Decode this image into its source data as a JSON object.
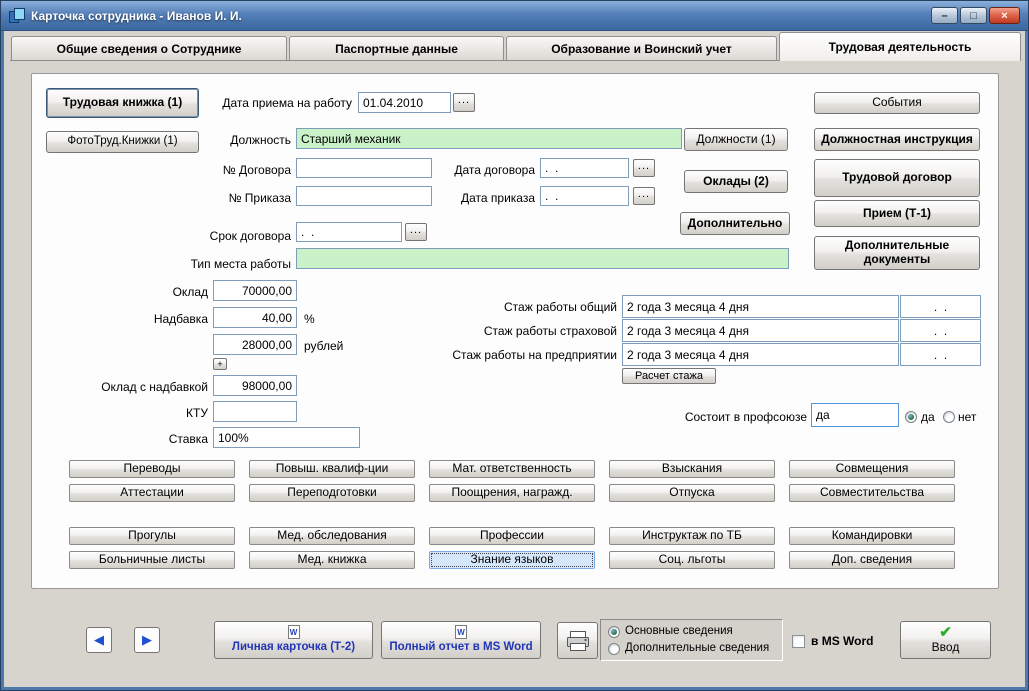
{
  "window": {
    "title": "Карточка сотрудника -  Иванов И. И.",
    "controls": {
      "minimize": "–",
      "maximize": "□",
      "close": "×"
    }
  },
  "tabs": [
    "Общие сведения о Сотруднике",
    "Паспортные данные",
    "Образование и Воинский учет",
    "Трудовая деятельность"
  ],
  "form": {
    "labor_book_btn": "Трудовая книжка (1)",
    "photo_book_btn": "ФотоТруд.Книжки (1)",
    "hire_date_label": "Дата приема на работу",
    "hire_date_value": "01.04.2010",
    "position_label": "Должность",
    "position_value": "Старший механик",
    "positions_btn": "Должности (1)",
    "contract_no_label": "№ Договора",
    "contract_no_value": "",
    "contract_date_label": "Дата договора",
    "contract_date_value": ".  .",
    "order_no_label": "№ Приказа",
    "order_no_value": "",
    "order_date_label": "Дата приказа",
    "order_date_value": ".  .",
    "salaries_btn": "Оклады (2)",
    "additional_btn": "Дополнительно",
    "contract_term_label": "Срок договора",
    "contract_term_value": ".  .",
    "workplace_type_label": "Тип места работы",
    "workplace_type_value": "",
    "salary_label": "Оклад",
    "salary_value": "70000,00",
    "bonus_label": "Надбавка",
    "bonus_value": "40,00",
    "bonus_unit": "%",
    "bonus_rub_value": "28000,00",
    "bonus_rub_unit": "рублей",
    "salary_total_label": "Оклад с надбавкой",
    "salary_total_value": "98000,00",
    "ktu_label": "КТУ",
    "ktu_value": "",
    "rate_label": "Ставка",
    "rate_value": "100%",
    "seniority": [
      {
        "label": "Стаж работы общий",
        "value": "2 года 3 месяца 4 дня",
        "date": ".  ."
      },
      {
        "label": "Стаж работы страховой",
        "value": "2 года 3 месяца 4 дня",
        "date": ".  ."
      },
      {
        "label": "Стаж работы на предприятии",
        "value": "2 года 3 месяца 4 дня",
        "date": ".  ."
      }
    ],
    "seniority_calc_btn": "Расчет стажа",
    "union_label": "Состоит в профсоюзе",
    "union_value": "да",
    "union_yes": "да",
    "union_no": "нет",
    "right_buttons": [
      "События",
      "Должностная инструкция",
      "Трудовой  договор",
      "Прием (Т-1)",
      "Дополнительные документы"
    ],
    "grid_rows": [
      [
        "Переводы",
        "Повыш. квалиф-ции",
        "Мат. ответственность",
        "Взыскания",
        "Совмещения"
      ],
      [
        "Аттестации",
        "Переподготовки",
        "Поощрения, награжд.",
        "Отпуска",
        "Совместительства"
      ],
      [
        "Прогулы",
        "Мед. обследования",
        "Профессии",
        "Инструктаж по ТБ",
        "Командировки"
      ],
      [
        "Больничные листы",
        "Мед. книжка",
        "Знание языков",
        "Соц. льготы",
        "Доп. сведения"
      ]
    ]
  },
  "footer": {
    "personal_card_btn": "Личная карточка (Т-2)",
    "full_report_btn": "Полный отчет в MS Word",
    "radio_main": "Основные сведения",
    "radio_additional": "Дополнительные сведения",
    "msword_checkbox": "в MS Word",
    "enter_btn": "Ввод"
  },
  "icons": {
    "ellipsis": "...",
    "plus": "+",
    "prev": "◀",
    "next": "▶",
    "check": "✔",
    "word_doc_letter": "W"
  },
  "colors": {
    "titlebar_blue": "#39689f",
    "field_green": "#c9f2c9",
    "link_blue": "#2135b5",
    "check_green": "#2fae2f",
    "focus_blue": "#d5e7fb"
  }
}
